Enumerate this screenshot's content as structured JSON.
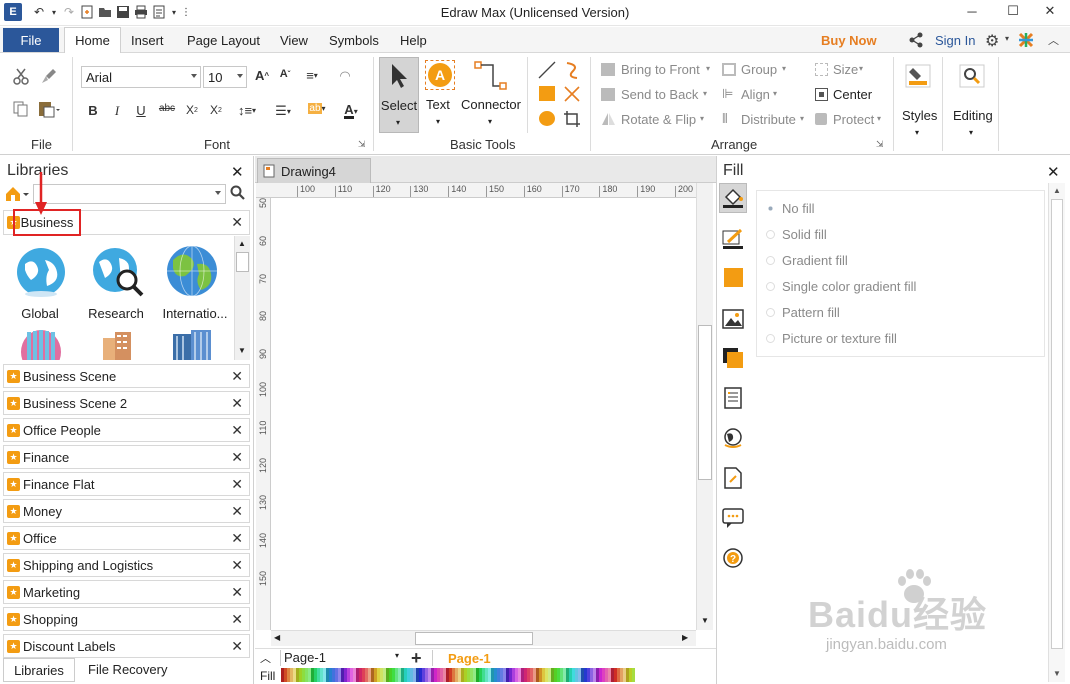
{
  "window": {
    "title": "Edraw Max (Unlicensed Version)"
  },
  "menu": {
    "file": "File",
    "tabs": [
      "Home",
      "Insert",
      "Page Layout",
      "View",
      "Symbols",
      "Help"
    ],
    "buy_now": "Buy Now",
    "sign_in": "Sign In"
  },
  "ribbon": {
    "groups": {
      "file": "File",
      "font": "Font",
      "basic_tools": "Basic Tools",
      "arrange": "Arrange"
    },
    "font_name": "Arial",
    "font_size": "10",
    "tools": {
      "select": "Select",
      "text": "Text",
      "connector": "Connector"
    },
    "arrange": {
      "bring_to_front": "Bring to Front",
      "send_to_back": "Send to Back",
      "rotate_flip": "Rotate & Flip",
      "group": "Group",
      "align": "Align",
      "distribute": "Distribute",
      "size": "Size",
      "center": "Center",
      "protect": "Protect"
    },
    "styles": "Styles",
    "editing": "Editing"
  },
  "libraries": {
    "title": "Libraries",
    "open_library": "Business",
    "shapes": [
      "Global",
      "Research",
      "Internatio..."
    ],
    "list": [
      "Business Scene",
      "Business Scene 2",
      "Office People",
      "Finance",
      "Finance Flat",
      "Money",
      "Office",
      "Shipping and Logistics",
      "Marketing",
      "Shopping",
      "Discount Labels"
    ],
    "bottom_tabs": [
      "Libraries",
      "File Recovery"
    ]
  },
  "document": {
    "tab": "Drawing4",
    "ruler_h": [
      "100",
      "110",
      "120",
      "130",
      "140",
      "150",
      "160",
      "170",
      "180",
      "190",
      "200"
    ],
    "ruler_v": [
      "50",
      "60",
      "70",
      "80",
      "90",
      "100",
      "110",
      "120",
      "130",
      "140",
      "150"
    ],
    "page_selector": "Page-1",
    "page_tab": "Page-1",
    "fill_label": "Fill"
  },
  "fill_panel": {
    "title": "Fill",
    "options": [
      "No fill",
      "Solid fill",
      "Gradient fill",
      "Single color gradient fill",
      "Pattern fill",
      "Picture or texture fill"
    ]
  },
  "watermark": {
    "brand": "Baidu经验",
    "url": "jingyan.baidu.com"
  },
  "colors": {
    "accent": "#2b579a",
    "buy_now": "#e67e22",
    "annotation": "#e02424",
    "page_tab": "#f39c12"
  }
}
